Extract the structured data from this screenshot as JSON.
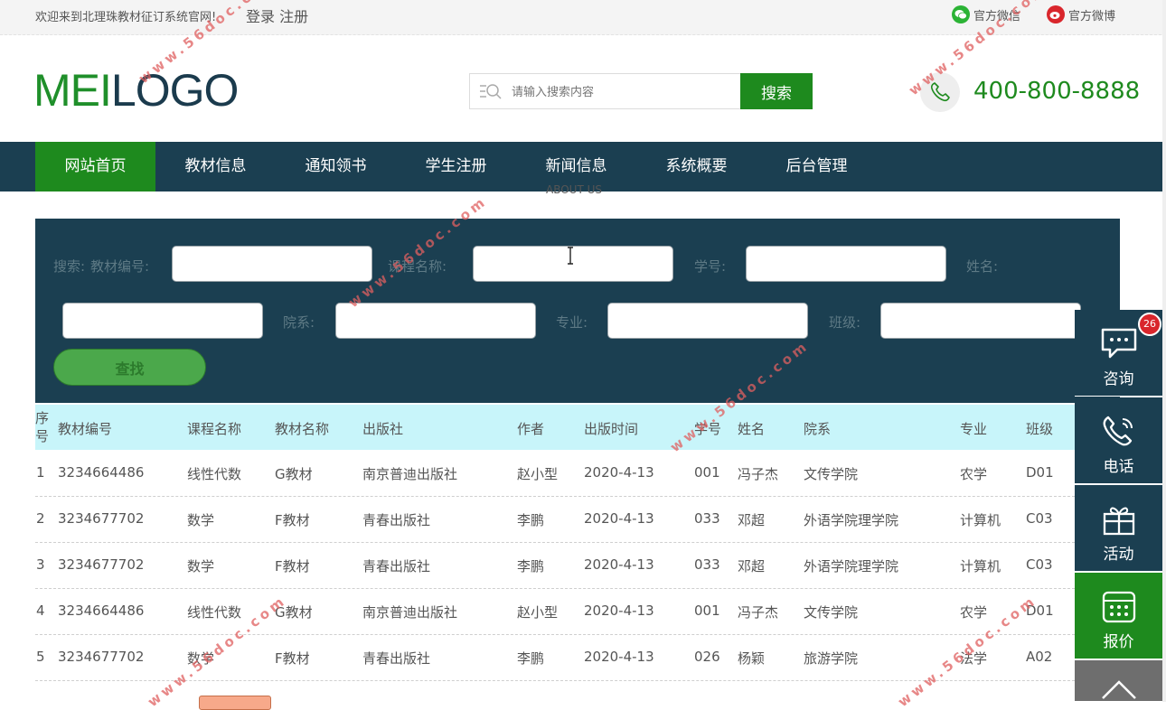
{
  "topbar": {
    "welcome": "欢迎来到北理珠教材征订系统官网!",
    "auth": "登录 注册",
    "wechat": "官方微信",
    "weibo": "官方微博"
  },
  "header": {
    "logo_part1": "MEI",
    "logo_part2": "LOGO",
    "search_placeholder": "请输入搜索内容",
    "search_button": "搜索",
    "phone": "400-800-8888"
  },
  "nav": {
    "items": [
      "网站首页",
      "教材信息",
      "通知领书",
      "学生注册",
      "新闻信息",
      "系统概要",
      "后台管理"
    ],
    "active_index": 0,
    "sub_label": "ABOUT US"
  },
  "search_panel": {
    "prefix": "搜索:",
    "labels": {
      "textbook_no": "教材编号:",
      "course_name": "课程名称:",
      "student_no": "学号:",
      "name": "姓名:",
      "department": "院系:",
      "major": "专业:",
      "class": "班级:"
    },
    "find_button": "查找"
  },
  "table": {
    "headers": [
      "序号",
      "教材编号",
      "课程名称",
      "教材名称",
      "出版社",
      "作者",
      "出版时间",
      "学号",
      "姓名",
      "院系",
      "专业",
      "班级"
    ],
    "rows": [
      [
        "1",
        "3234664486",
        "线性代数",
        "G教材",
        "南京普迪出版社",
        "赵小型",
        "2020-4-13",
        "001",
        "冯子杰",
        "文传学院",
        "农学",
        "D01"
      ],
      [
        "2",
        "3234677702",
        "数学",
        "F教材",
        "青春出版社",
        "李鹏",
        "2020-4-13",
        "033",
        "邓超",
        "外语学院理学院",
        "计算机",
        "C03"
      ],
      [
        "3",
        "3234677702",
        "数学",
        "F教材",
        "青春出版社",
        "李鹏",
        "2020-4-13",
        "033",
        "邓超",
        "外语学院理学院",
        "计算机",
        "C03"
      ],
      [
        "4",
        "3234664486",
        "线性代数",
        "G教材",
        "南京普迪出版社",
        "赵小型",
        "2020-4-13",
        "001",
        "冯子杰",
        "文传学院",
        "农学",
        "D01"
      ],
      [
        "5",
        "3234677702",
        "数学",
        "F教材",
        "青春出版社",
        "李鹏",
        "2020-4-13",
        "026",
        "杨颖",
        "旅游学院",
        "法学",
        "A02"
      ]
    ]
  },
  "side": {
    "consult": "咨询",
    "consult_badge": "26",
    "phone": "电话",
    "activity": "活动",
    "quote": "报价"
  },
  "watermark": "www.56doc.com",
  "colors": {
    "brand_green": "#1e8a1e",
    "nav_navy": "#1b3f51",
    "table_header": "#c8f5fa"
  }
}
